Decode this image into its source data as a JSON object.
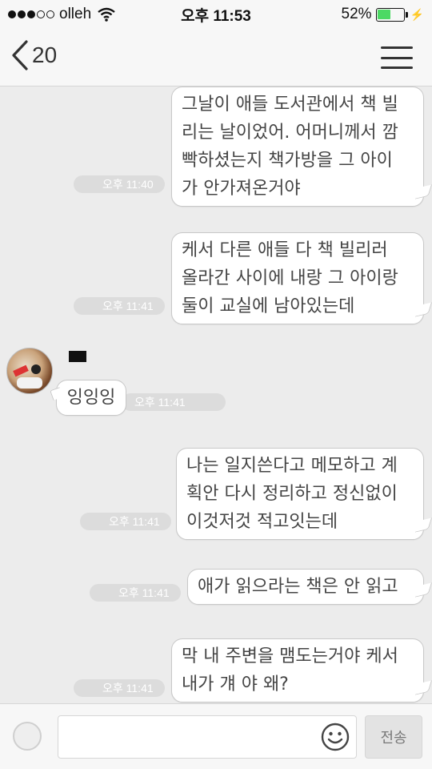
{
  "status_bar": {
    "carrier": "olleh",
    "time": "오후 11:53",
    "battery_percent": "52%",
    "battery_level": 0.52,
    "battery_color": "#4cd964"
  },
  "nav": {
    "back_count": "20",
    "title": "",
    "back_icon": "chevron-left-icon",
    "menu_icon": "hamburger-menu-icon"
  },
  "messages": [
    {
      "side": "right",
      "text": "그날이 애들 도서관에서 책 빌\n리는 날이었어. 어머니께서 깜\n빡하셨는지 책가방을 그 아이\n가 안가져온거야",
      "time": "오후 11:40"
    },
    {
      "side": "right",
      "text": "케서 다른 애들 다 책 빌리러\n올라간 사이에 내랑 그 아이랑\n둘이 교실에 남아있는데",
      "time": "오후 11:41"
    },
    {
      "side": "left",
      "sender": "",
      "text": "잉잉잉",
      "time": "오후 11:41"
    },
    {
      "side": "right",
      "text": "나는 일지쓴다고 메모하고 계\n획안 다시 정리하고 정신없이\n이것저것 적고잇는데",
      "time": "오후 11:41"
    },
    {
      "side": "right",
      "text": "애가 읽으라는 책은 안 읽고",
      "time": "오후 11:41"
    },
    {
      "side": "right",
      "text": "막 내 주변을 맴도는거야 케서\n내가 걔    야 왜?",
      "time": "오후 11:41"
    }
  ],
  "input_bar": {
    "placeholder": "",
    "send_label": "전송",
    "emoji_icon": "smiley-icon",
    "plus_icon": "attach-circle-icon"
  },
  "colors": {
    "background": "#ececec",
    "bubble": "#ffffff",
    "bubble_border": "#c8c8c8",
    "timestamp_pill": "#dcdcdc"
  }
}
